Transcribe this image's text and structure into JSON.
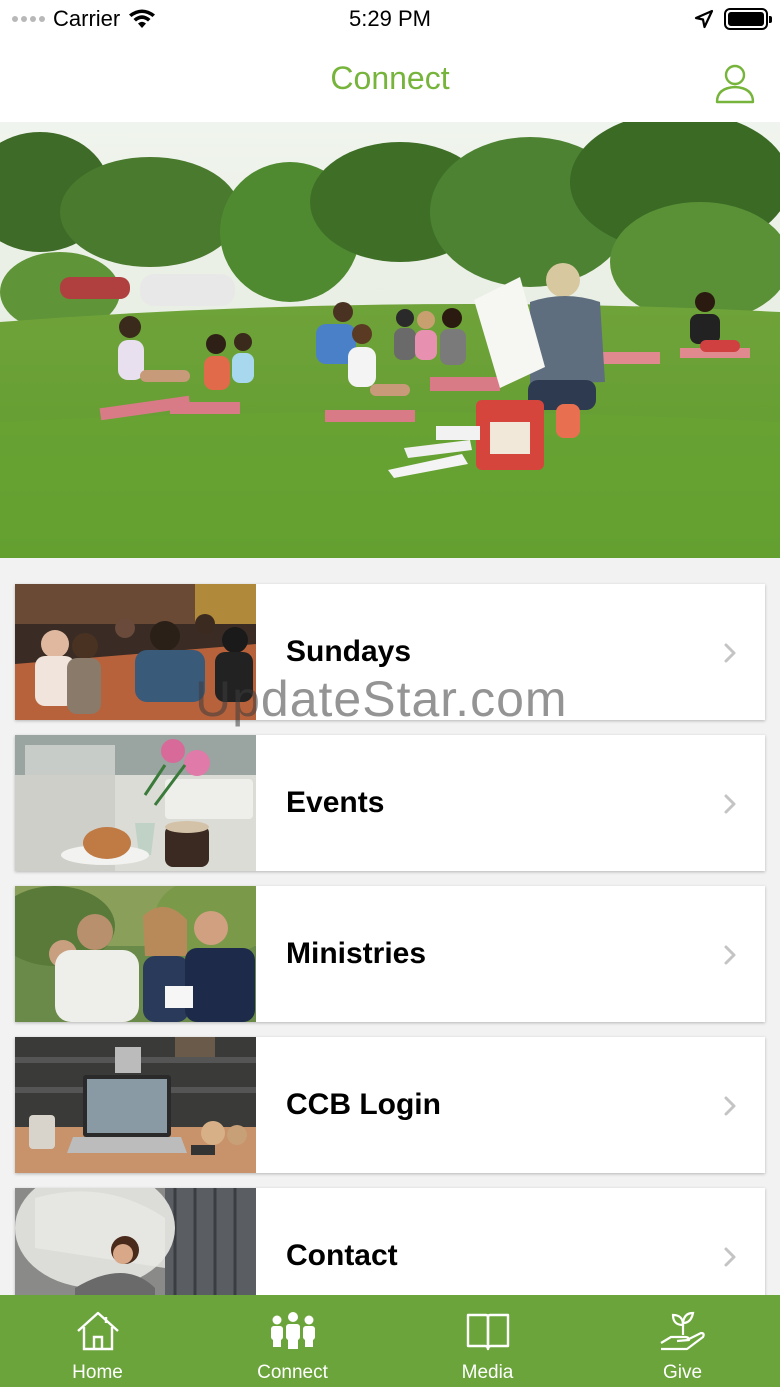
{
  "status_bar": {
    "carrier": "Carrier",
    "time": "5:29 PM"
  },
  "header": {
    "title": "Connect",
    "title_color": "#76b43b",
    "profile_icon": "person-icon"
  },
  "hero": {
    "icon": "outdoor-group-photo"
  },
  "list": {
    "items": [
      {
        "label": "Sundays"
      },
      {
        "label": "Events"
      },
      {
        "label": "Ministries"
      },
      {
        "label": "CCB Login"
      },
      {
        "label": "Contact"
      }
    ]
  },
  "watermark": "UpdateStar.com",
  "tabbar": {
    "color": "#6aa43a",
    "items": [
      {
        "label": "Home",
        "icon": "house-icon"
      },
      {
        "label": "Connect",
        "icon": "people-icon"
      },
      {
        "label": "Media",
        "icon": "book-icon"
      },
      {
        "label": "Give",
        "icon": "hand-plant-icon"
      }
    ]
  }
}
